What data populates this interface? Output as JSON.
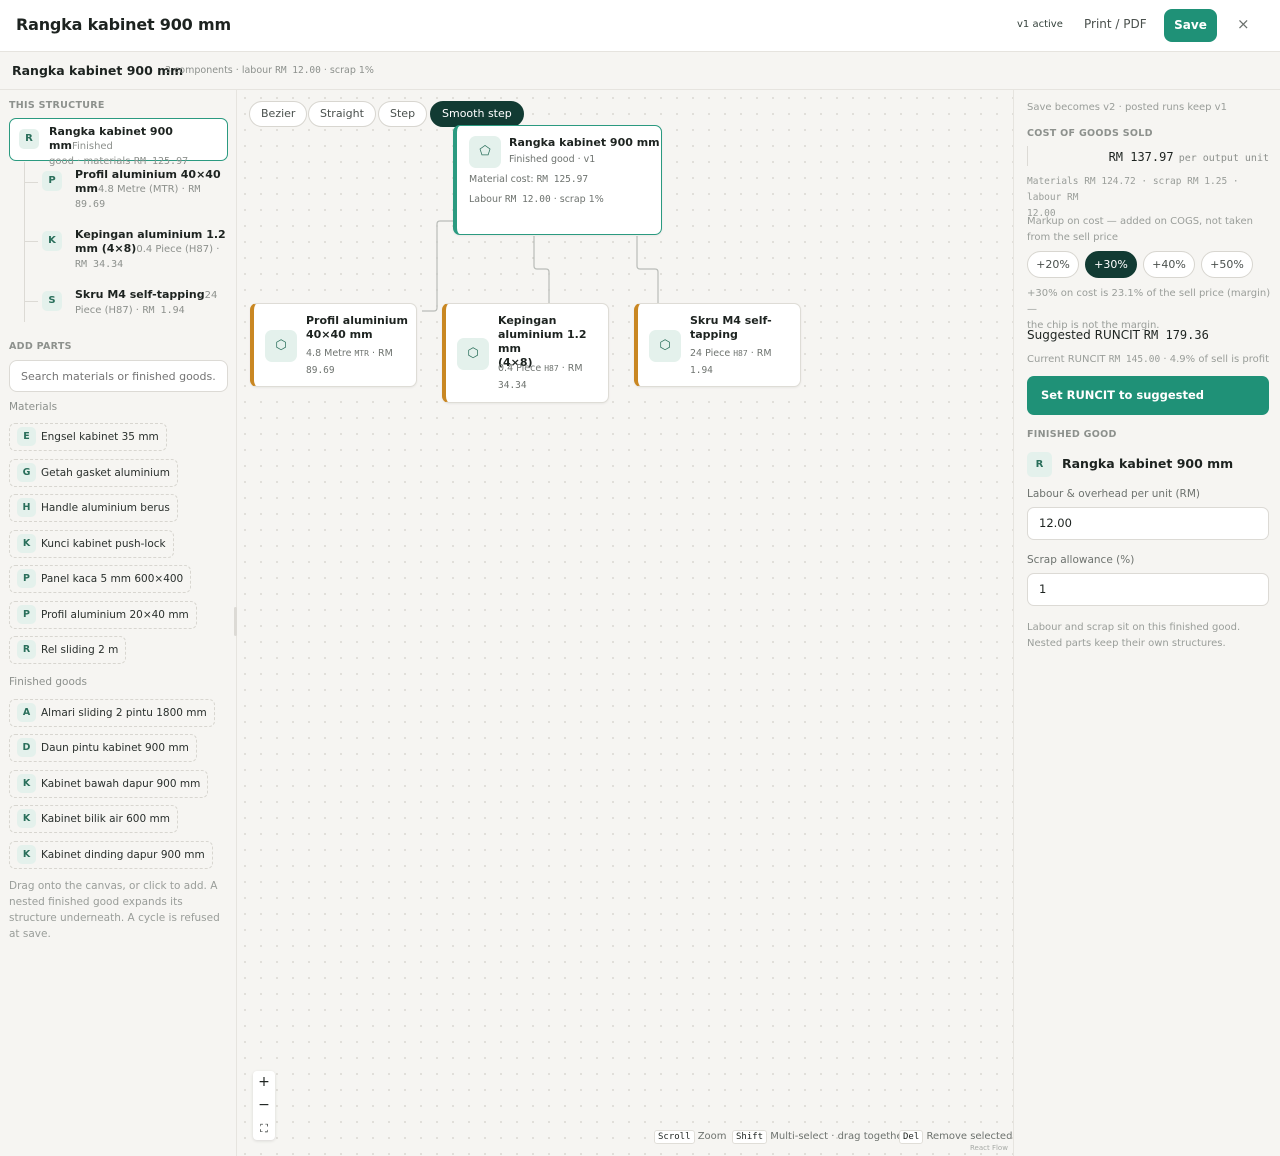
{
  "header": {
    "title": "Rangka kabinet 900 mm",
    "version": "v1 active",
    "print_label": "Print / PDF",
    "save_label": "Save",
    "close_symbol": "×"
  },
  "subheader": {
    "name": "Rangka kabinet 900 mm",
    "meta_components": "3 components ·",
    "meta_labour_label": "labour",
    "meta_labour_value": "RM 12.00",
    "meta_scrap": "· scrap 1%"
  },
  "structure": {
    "heading": "This structure",
    "root": {
      "badge": "R",
      "name": "Rangka kabinet 900 mm",
      "tag": "Finished",
      "line2": "good · materials",
      "amount": "RM 125.97"
    },
    "items": [
      {
        "badge": "P",
        "name_a": "Profil aluminium 40×40",
        "name_b": "mm",
        "qty": "4.8 Metre (MTR) ·",
        "amount": "RM 89.69"
      },
      {
        "badge": "K",
        "name_a": "Kepingan aluminium 1.2",
        "name_b": "mm (4×8)",
        "qty": "0.4 Piece (H87) ·",
        "amount": "RM 34.34"
      },
      {
        "badge": "S",
        "name_a": "Skru M4 self-tapping",
        "qty_a": "24",
        "qty_b": "Piece (H87) ·",
        "amount": "RM 1.94"
      }
    ]
  },
  "add_parts": {
    "heading": "Add parts",
    "search_placeholder": "Search materials or finished goods...",
    "materials_label": "Materials",
    "materials": [
      {
        "badge": "E",
        "label": "Engsel kabinet 35 mm"
      },
      {
        "badge": "G",
        "label": "Getah gasket aluminium"
      },
      {
        "badge": "H",
        "label": "Handle aluminium berus"
      },
      {
        "badge": "K",
        "label": "Kunci kabinet push-lock"
      },
      {
        "badge": "P",
        "label": "Panel kaca 5 mm 600×400"
      },
      {
        "badge": "P",
        "label": "Profil aluminium 20×40 mm"
      },
      {
        "badge": "R",
        "label": "Rel sliding 2 m"
      }
    ],
    "finished_label": "Finished goods",
    "finished": [
      {
        "badge": "A",
        "label": "Almari sliding 2 pintu 1800 mm"
      },
      {
        "badge": "D",
        "label": "Daun pintu kabinet 900 mm"
      },
      {
        "badge": "K",
        "label": "Kabinet bawah dapur 900 mm"
      },
      {
        "badge": "K",
        "label": "Kabinet bilik air 600 mm"
      },
      {
        "badge": "K",
        "label": "Kabinet dinding dapur 900 mm"
      }
    ],
    "hint": "Drag onto the canvas, or click to add. A nested finished good expands its structure underneath. A cycle is refused at save."
  },
  "canvas": {
    "edge_styles": [
      "Bezier",
      "Straight",
      "Step",
      "Smooth step"
    ],
    "active_style": "Smooth step",
    "root_node": {
      "title": "Rangka kabinet 900 mm",
      "subtitle": "Finished good · v1",
      "material_label": "Material cost:",
      "material_value": "RM 125.97",
      "labour_label": "Labour",
      "labour_value": "RM 12.00",
      "scrap": "· scrap 1%"
    },
    "part_nodes": [
      {
        "title_lines": [
          "Profil aluminium",
          "40×40 mm"
        ],
        "qty": "4.8 Metre",
        "unit": "MTR",
        "rm": "· RM",
        "amount": "89.69"
      },
      {
        "title_lines": [
          "Kepingan",
          "aluminium 1.2 mm",
          "(4×8)"
        ],
        "qty": "0.4 Piece",
        "unit": "H87",
        "rm": "· RM",
        "amount": "34.34"
      },
      {
        "title_lines": [
          "Skru M4 self-",
          "tapping"
        ],
        "qty": "24 Piece",
        "unit": "H87",
        "rm": "· RM",
        "amount": "1.94"
      }
    ],
    "shortcuts": [
      {
        "key": "Scroll",
        "label": "Zoom"
      },
      {
        "key": "Shift",
        "label": "Multi-select · drag together"
      },
      {
        "key": "Del",
        "label": "Remove selected"
      }
    ],
    "attribution": "React Flow",
    "zoom_in": "+",
    "zoom_out": "−",
    "fit": "⛶"
  },
  "costing": {
    "save_note": "Save becomes v2 · posted runs keep v1",
    "cogs_heading": "Cost of goods sold",
    "cogs_value": "RM 137.97",
    "cogs_suffix": "per output unit",
    "breakdown_line1": "Materials RM 124.72 · scrap RM 1.25 · labour RM",
    "breakdown_line2": "12.00",
    "markup_note_1": "Markup on cost — added on COGS, not taken",
    "markup_note_2": "from the sell price",
    "markups": [
      "+20%",
      "+30%",
      "+40%",
      "+50%"
    ],
    "active_markup": "+30%",
    "margin_note_1": "+30% on cost is 23.1% of the sell price (margin) —",
    "margin_note_2": "the chip is not the margin.",
    "suggested_label": "Suggested RUNCIT",
    "suggested_value": "RM 179.36",
    "current_label": "Current RUNCIT",
    "current_value": "RM 145.00",
    "current_suffix": "· 4.9% of sell is profit",
    "set_button": "Set RUNCIT to suggested"
  },
  "finished_good": {
    "heading": "Finished good",
    "badge": "R",
    "name": "Rangka kabinet 900 mm",
    "labour_label": "Labour & overhead per unit (RM)",
    "labour_value": "12.00",
    "scrap_label": "Scrap allowance (%)",
    "scrap_value": "1",
    "footer_1": "Labour and scrap sit on this finished good.",
    "footer_2": "Nested parts keep their own structures."
  },
  "colors": {
    "accent": "#1f9177",
    "dark": "#123b33",
    "part_border": "#c98722"
  }
}
